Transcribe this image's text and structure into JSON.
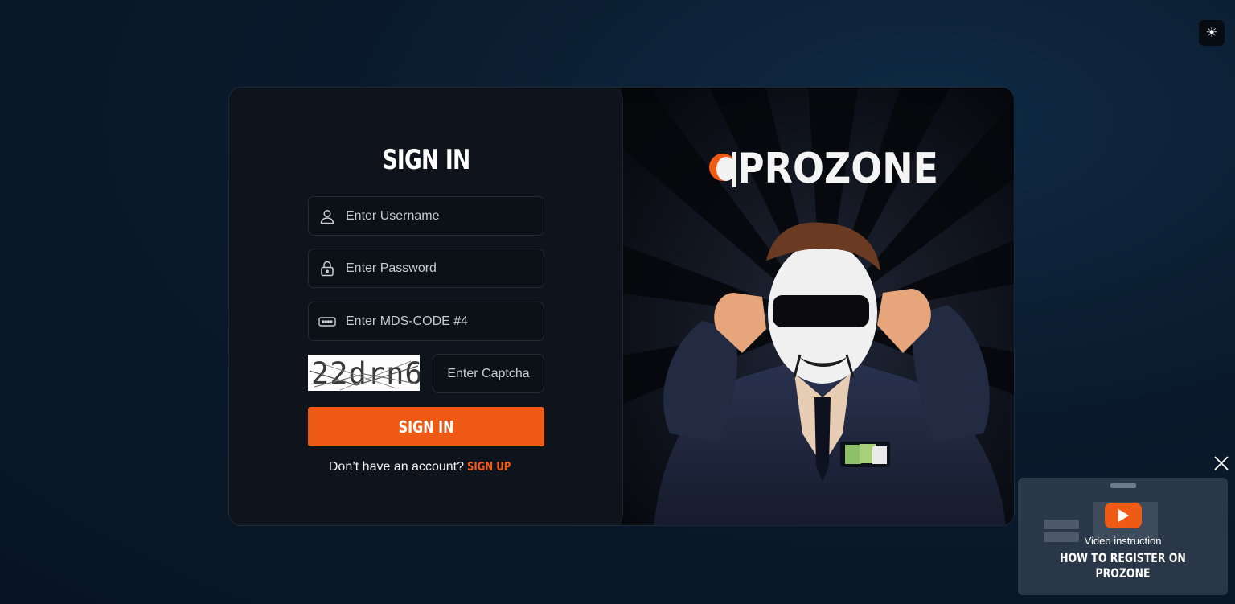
{
  "theme_toggle": {
    "icon": "sun-icon"
  },
  "login": {
    "title": "SIGN IN",
    "username": {
      "placeholder": "Enter Username",
      "icon": "user-icon"
    },
    "password": {
      "placeholder": "Enter Password",
      "icon": "lock-icon"
    },
    "mds_code": {
      "placeholder": "Enter MDS-CODE #4",
      "icon": "keypad-icon"
    },
    "captcha": {
      "image_text": "22drn6",
      "placeholder": "Enter Captcha"
    },
    "submit_label": "SIGN IN",
    "signup_prompt": "Don’t have an account?",
    "signup_link": "SIGN UP"
  },
  "brand": {
    "name": "PROZONE"
  },
  "video": {
    "subtitle": "Video instruction",
    "title": "HOW TO REGISTER ON PROZONE"
  },
  "colors": {
    "accent": "#ee5a14",
    "panel": "#0f131b",
    "background": "#0a1a2c"
  }
}
